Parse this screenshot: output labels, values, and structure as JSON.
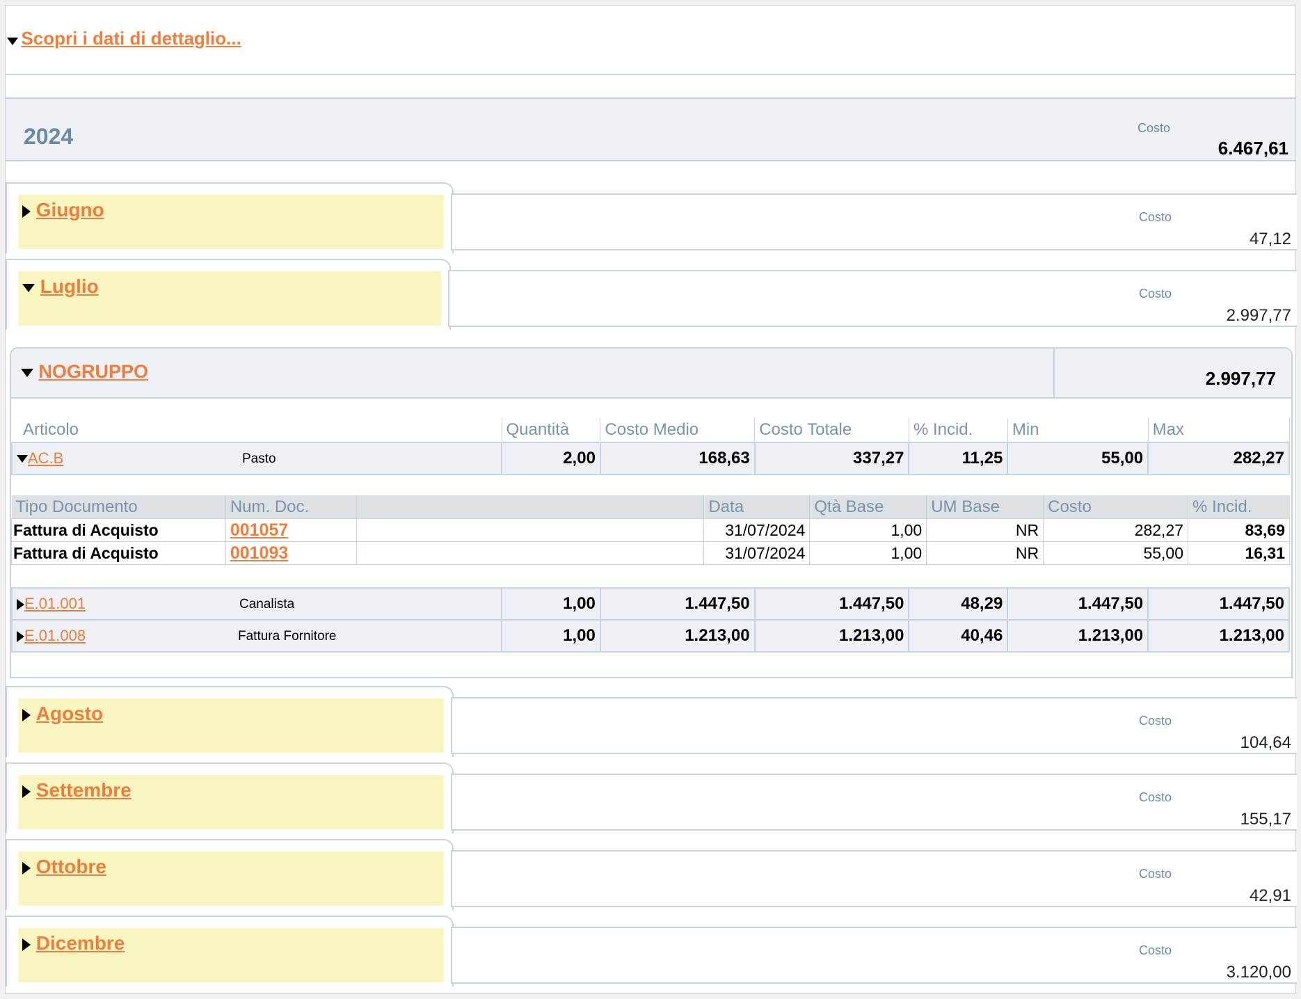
{
  "header": {
    "link": "Scopri i dati di dettaglio..."
  },
  "year": {
    "label": "2024",
    "cost_label": "Costo",
    "cost_value": "6.467,61"
  },
  "months": {
    "giugno": {
      "label": " Giugno",
      "cost_label": "Costo",
      "cost_value": "47,12"
    },
    "luglio": {
      "label": " Luglio",
      "cost_label": "Costo",
      "cost_value": "2.997,77"
    },
    "agosto": {
      "label": " Agosto",
      "cost_label": "Costo",
      "cost_value": "104,64"
    },
    "settembre": {
      "label": " Settembre",
      "cost_label": "Costo",
      "cost_value": "155,17"
    },
    "ottobre": {
      "label": " Ottobre",
      "cost_label": "Costo",
      "cost_value": "42,91"
    },
    "dicembre": {
      "label": " Dicembre",
      "cost_label": "Costo",
      "cost_value": "3.120,00"
    }
  },
  "group": {
    "label": " NOGRUPPO",
    "total": "2.997,77",
    "columns": [
      "Articolo",
      "Quantità",
      "Costo Medio",
      "Costo Totale",
      "% Incid.",
      "Min",
      "Max"
    ],
    "articles": [
      {
        "code": "AC.B ",
        "desc": "Pasto",
        "qty": "2,00",
        "avg": "168,63",
        "total": "337,27",
        "incid": "11,25",
        "min": "55,00",
        "max": "282,27"
      },
      {
        "code": "E.01.001 ",
        "desc": "Canalista",
        "qty": "1,00",
        "avg": "1.447,50",
        "total": "1.447,50",
        "incid": "48,29",
        "min": "1.447,50",
        "max": "1.447,50"
      },
      {
        "code": "E.01.008 ",
        "desc": "Fattura Fornitore",
        "qty": "1,00",
        "avg": "1.213,00",
        "total": "1.213,00",
        "incid": "40,46",
        "min": "1.213,00",
        "max": "1.213,00"
      }
    ],
    "doc_columns": [
      "Tipo Documento",
      "Num. Doc.",
      "",
      "Data",
      "Qtà Base",
      "UM Base",
      "Costo",
      "% Incid."
    ],
    "docs": [
      {
        "type": "Fattura di Acquisto",
        "num": "001057",
        "date": "31/07/2024",
        "qty": "1,00",
        "um": "NR",
        "cost": "282,27",
        "incid": "83,69"
      },
      {
        "type": "Fattura di Acquisto",
        "num": "001093",
        "date": "31/07/2024",
        "qty": "1,00",
        "um": "NR",
        "cost": "55,00",
        "incid": "16,31"
      }
    ]
  }
}
